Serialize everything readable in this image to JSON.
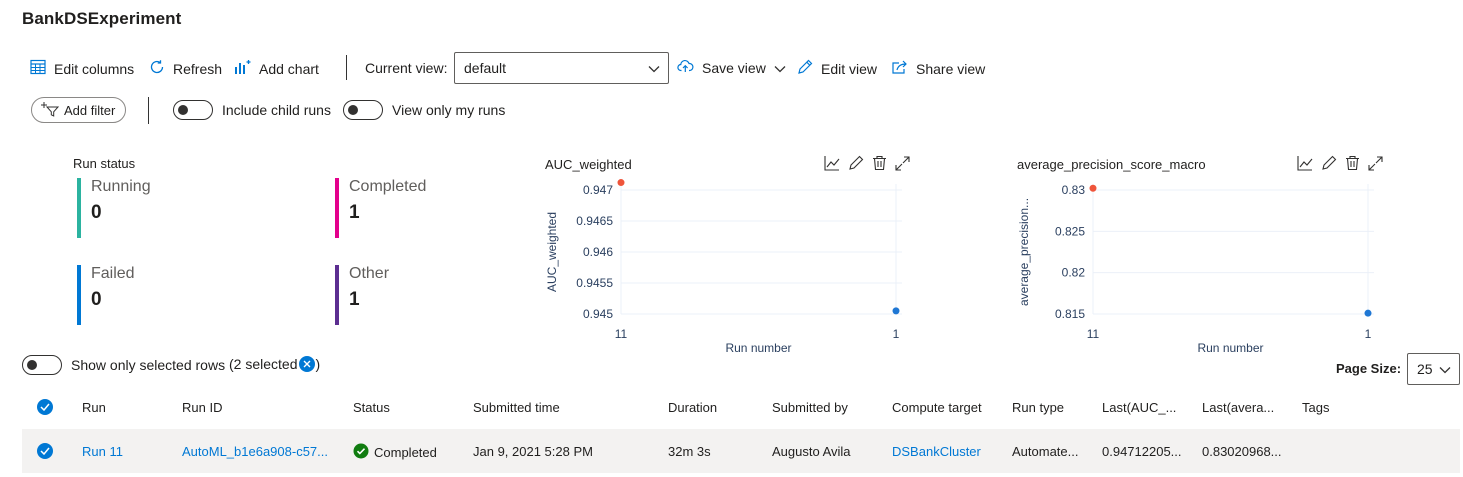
{
  "experiment_title": "BankDSExperiment",
  "toolbar": {
    "edit_columns": "Edit columns",
    "refresh": "Refresh",
    "add_chart": "Add chart",
    "current_view_label": "Current view:",
    "current_view_value": "default",
    "save_view": "Save view",
    "edit_view": "Edit view",
    "share_view": "Share view"
  },
  "filters": {
    "add_filter": "Add filter",
    "include_child_runs": "Include child runs",
    "view_only_my_runs": "View only my runs"
  },
  "run_status": {
    "title": "Run status",
    "items": [
      {
        "label": "Running",
        "count": "0",
        "color": "#2bb3a0"
      },
      {
        "label": "Completed",
        "count": "1",
        "color": "#e3008c"
      },
      {
        "label": "Failed",
        "count": "0",
        "color": "#0078d4"
      },
      {
        "label": "Other",
        "count": "1",
        "color": "#5c2e91"
      }
    ]
  },
  "charts": [
    {
      "title": "AUC_weighted",
      "ylabel": "AUC_weighted",
      "xlabel": "Run number"
    },
    {
      "title": "average_precision_score_macro",
      "ylabel": "average_precision...",
      "xlabel": "Run number"
    }
  ],
  "chart_data": [
    {
      "type": "scatter",
      "title": "AUC_weighted",
      "xlabel": "Run number",
      "ylabel": "AUC_weighted",
      "categories": [
        "11",
        "1"
      ],
      "y_ticks": [
        "0.945",
        "0.9455",
        "0.946",
        "0.9465",
        "0.947"
      ],
      "ylim": [
        0.945,
        0.947
      ],
      "points": [
        {
          "x": "11",
          "y": 0.94712,
          "color": "#ef553b"
        },
        {
          "x": "1",
          "y": 0.94505,
          "color": "#1f77d4"
        }
      ],
      "grid": true
    },
    {
      "type": "scatter",
      "title": "average_precision_score_macro",
      "xlabel": "Run number",
      "ylabel": "average_precision...",
      "categories": [
        "11",
        "1"
      ],
      "y_ticks": [
        "0.815",
        "0.82",
        "0.825",
        "0.83"
      ],
      "ylim": [
        0.815,
        0.83
      ],
      "points": [
        {
          "x": "11",
          "y": 0.83021,
          "color": "#ef553b"
        },
        {
          "x": "1",
          "y": 0.8151,
          "color": "#1f77d4"
        }
      ],
      "grid": true
    }
  ],
  "selection": {
    "show_only_selected": "Show only selected rows",
    "selected_count": "(2 selected",
    "close_paren": ")"
  },
  "page_size": {
    "label": "Page Size:",
    "value": "25"
  },
  "table": {
    "headers": [
      "Run",
      "Run ID",
      "Status",
      "Submitted time",
      "Duration",
      "Submitted by",
      "Compute target",
      "Run type",
      "Last(AUC_...",
      "Last(avera...",
      "Tags"
    ],
    "rows": [
      {
        "run": "Run 11",
        "run_id": "AutoML_b1e6a908-c57...",
        "status": "Completed",
        "submitted_time": "Jan 9, 2021 5:28 PM",
        "duration": "32m 3s",
        "submitted_by": "Augusto Avila",
        "compute_target": "DSBankCluster",
        "run_type": "Automate...",
        "last_auc": "0.94712205...",
        "last_avg": "0.83020968...",
        "tags": ""
      }
    ]
  }
}
